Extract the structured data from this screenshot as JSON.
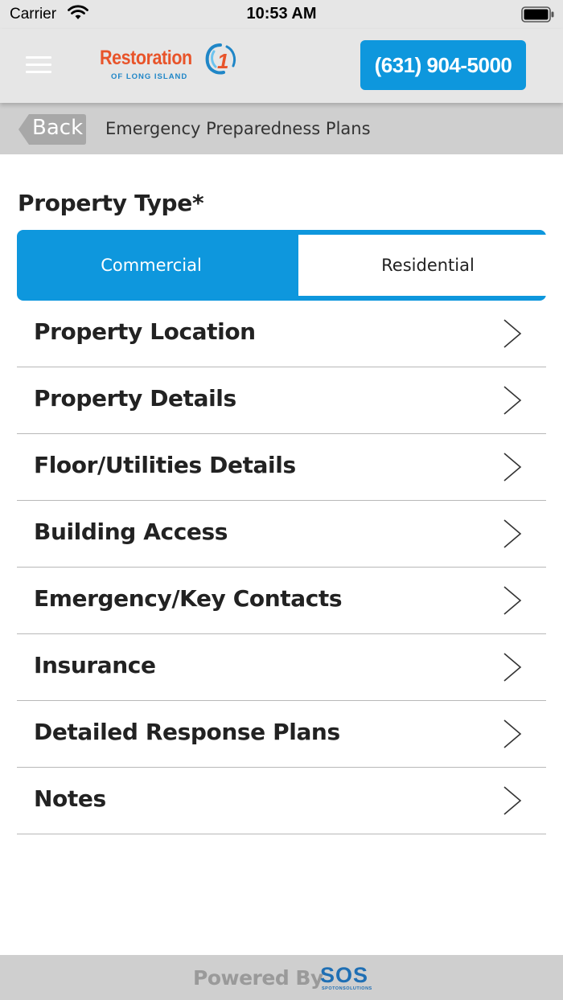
{
  "status_bar": {
    "carrier": "Carrier",
    "time": "10:53 AM"
  },
  "header": {
    "logo": {
      "name": "Restoration",
      "number": "1",
      "subtitle": "OF LONG ISLAND"
    },
    "phone_button_label": "(631) 904-5000"
  },
  "title_bar": {
    "back_label": "Back",
    "title": "Emergency Preparedness Plans"
  },
  "property_type": {
    "label": "Property Type*",
    "options": [
      "Commercial",
      "Residential"
    ],
    "selected": "Commercial"
  },
  "sections": [
    {
      "label": "Property Location"
    },
    {
      "label": "Property Details"
    },
    {
      "label": "Floor/Utilities Details"
    },
    {
      "label": "Building Access"
    },
    {
      "label": "Emergency/Key Contacts"
    },
    {
      "label": "Insurance"
    },
    {
      "label": "Detailed Response Plans"
    },
    {
      "label": "Notes"
    }
  ],
  "footer": {
    "powered_by": "Powered By",
    "sos_logo": "SOS",
    "sos_logo_sub": "SPOTONSOLUTIONS"
  },
  "colors": {
    "accent": "#0e97dd",
    "logo_orange": "#e8542a",
    "logo_blue": "#1f86c7",
    "header_bg": "#e6e6e6",
    "title_bar_bg": "#cfcfcf"
  }
}
